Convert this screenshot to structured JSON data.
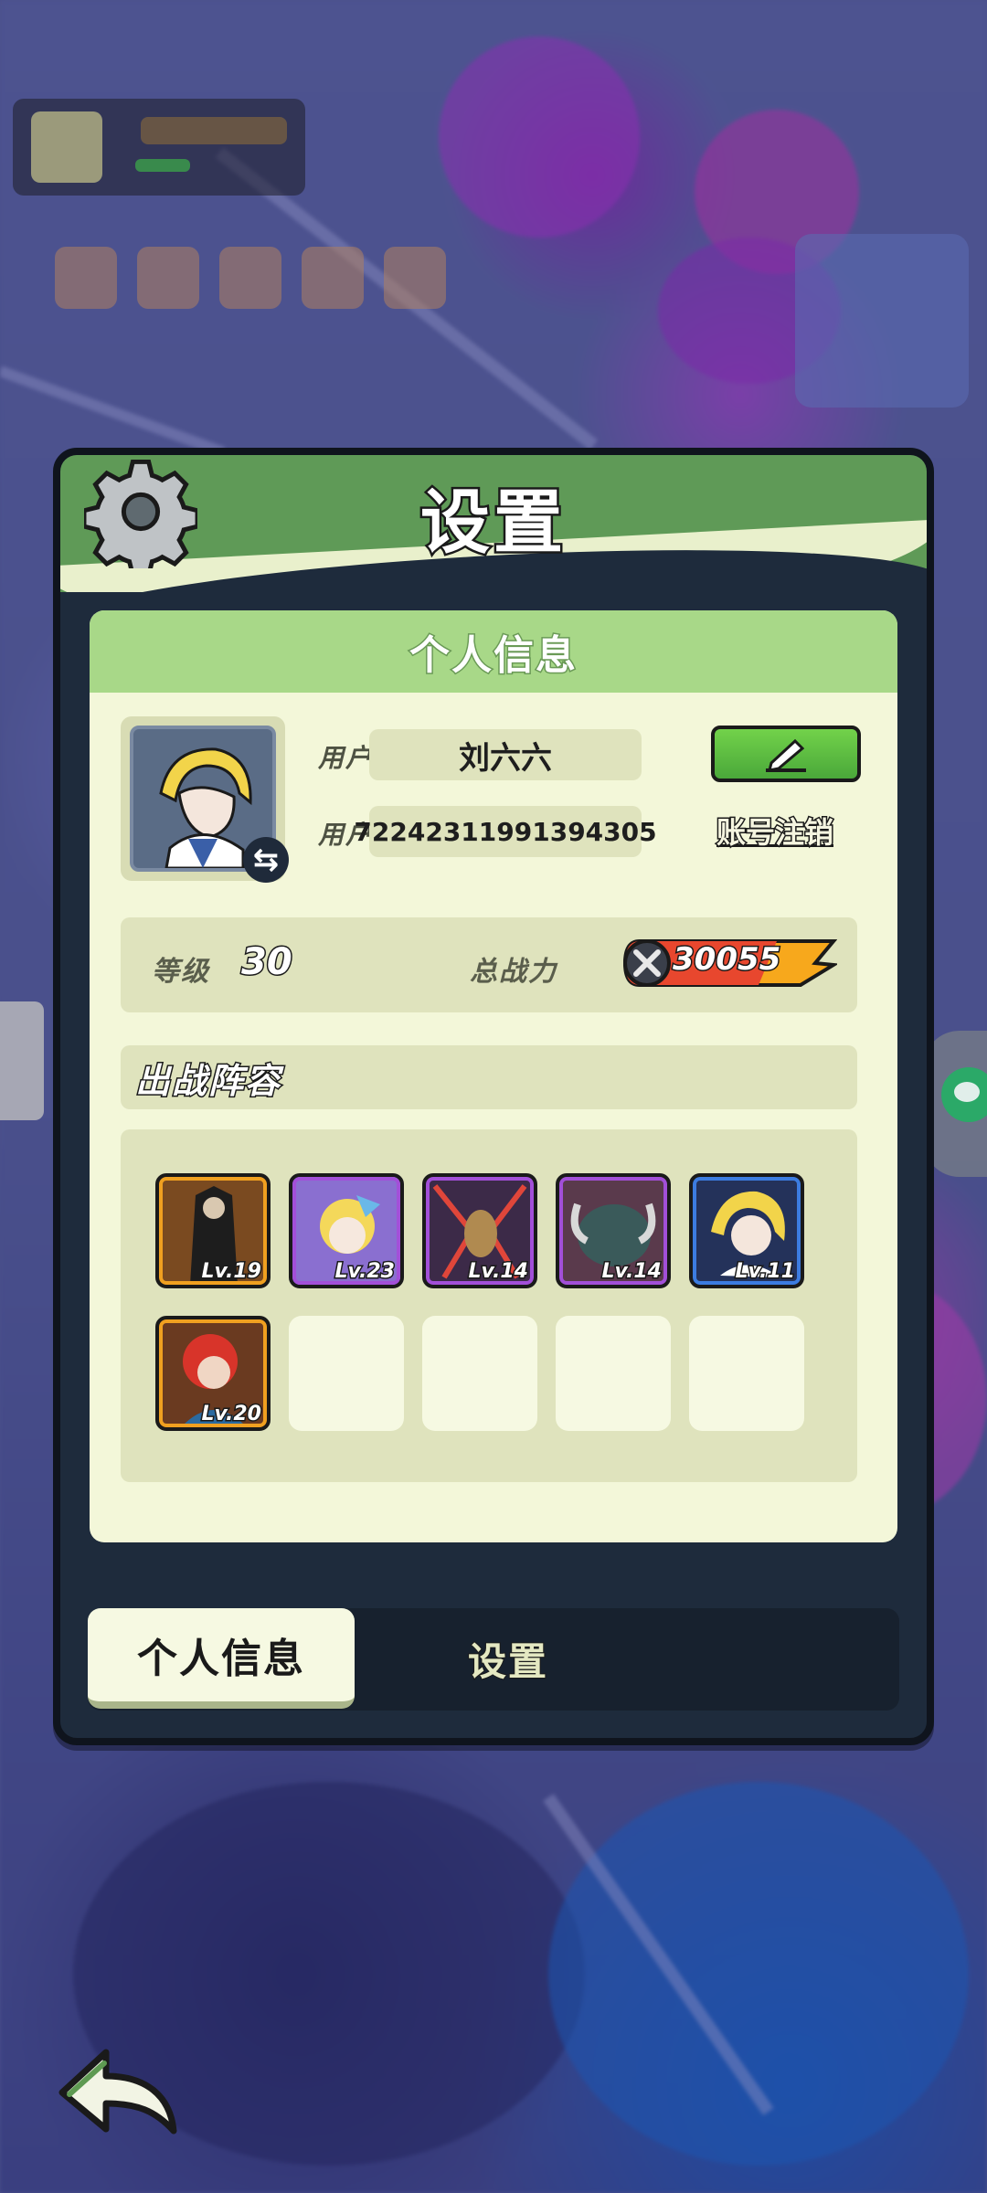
{
  "dialog": {
    "title": "设置",
    "panel_title": "个人信息"
  },
  "profile": {
    "nickname_label": "用户昵称",
    "nickname": "刘六六",
    "id_label": "用户　ID",
    "user_id": "72242311991394305",
    "cancel_account_label": "账号注销"
  },
  "stats": {
    "level_label": "等级",
    "level": "30",
    "power_label": "总战力",
    "power": "30055"
  },
  "lineup": {
    "title": "出战阵容",
    "heroes": [
      {
        "level": "Lv.19",
        "rarity": "orange"
      },
      {
        "level": "Lv.23",
        "rarity": "purple"
      },
      {
        "level": "Lv.14",
        "rarity": "purple"
      },
      {
        "level": "Lv.14",
        "rarity": "purple"
      },
      {
        "level": "Lv.11",
        "rarity": "blue"
      },
      {
        "level": "Lv.20",
        "rarity": "orange"
      }
    ],
    "empty_slots": 4
  },
  "tabs": {
    "active": "个人信息",
    "inactive": "设置"
  },
  "colors": {
    "orange_frame": "#f0a020",
    "purple_frame": "#a24fd8",
    "blue_frame": "#3c7ce0",
    "header_green": "#5f9a57",
    "button_green": "#5ec040"
  }
}
